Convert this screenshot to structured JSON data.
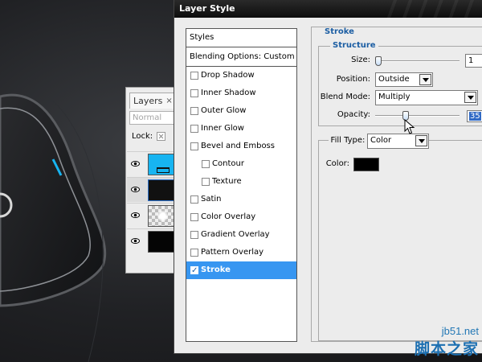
{
  "colors": {
    "accent_blue": "#17b4f1",
    "selection": "#3796f1",
    "legend_text": "#1c5ea3",
    "stroke_color": "#000000"
  },
  "layers_panel": {
    "tab_label": "Layers",
    "close_glyph": "×",
    "blend_mode": "Normal",
    "lock_label": "Lock:",
    "rows": [
      {
        "thumb": "blue-fill"
      },
      {
        "thumb": "black-shape"
      },
      {
        "thumb": "glow"
      },
      {
        "thumb": "black-background"
      }
    ]
  },
  "dialog": {
    "title": "Layer Style",
    "styles_header": "Styles",
    "blending_header": "Blending Options: Custom",
    "style_items": [
      {
        "label": "Drop Shadow",
        "checked": false,
        "sub": false
      },
      {
        "label": "Inner Shadow",
        "checked": false,
        "sub": false
      },
      {
        "label": "Outer Glow",
        "checked": false,
        "sub": false
      },
      {
        "label": "Inner Glow",
        "checked": false,
        "sub": false
      },
      {
        "label": "Bevel and Emboss",
        "checked": false,
        "sub": false
      },
      {
        "label": "Contour",
        "checked": false,
        "sub": true
      },
      {
        "label": "Texture",
        "checked": false,
        "sub": true
      },
      {
        "label": "Satin",
        "checked": false,
        "sub": false
      },
      {
        "label": "Color Overlay",
        "checked": false,
        "sub": false
      },
      {
        "label": "Gradient Overlay",
        "checked": false,
        "sub": false
      },
      {
        "label": "Pattern Overlay",
        "checked": false,
        "sub": false
      },
      {
        "label": "Stroke",
        "checked": true,
        "sub": false,
        "active": true
      }
    ],
    "stroke": {
      "section_title": "Stroke",
      "structure_title": "Structure",
      "size_label": "Size:",
      "size_value": "1",
      "position_label": "Position:",
      "position_value": "Outside",
      "blend_label": "Blend Mode:",
      "blend_value": "Multiply",
      "opacity_label": "Opacity:",
      "opacity_value": "35",
      "fill_type_label": "Fill Type:",
      "fill_type_value": "Color",
      "color_label": "Color:"
    }
  },
  "watermark": {
    "url": "jb51.net",
    "site_name": "脚本之家"
  }
}
